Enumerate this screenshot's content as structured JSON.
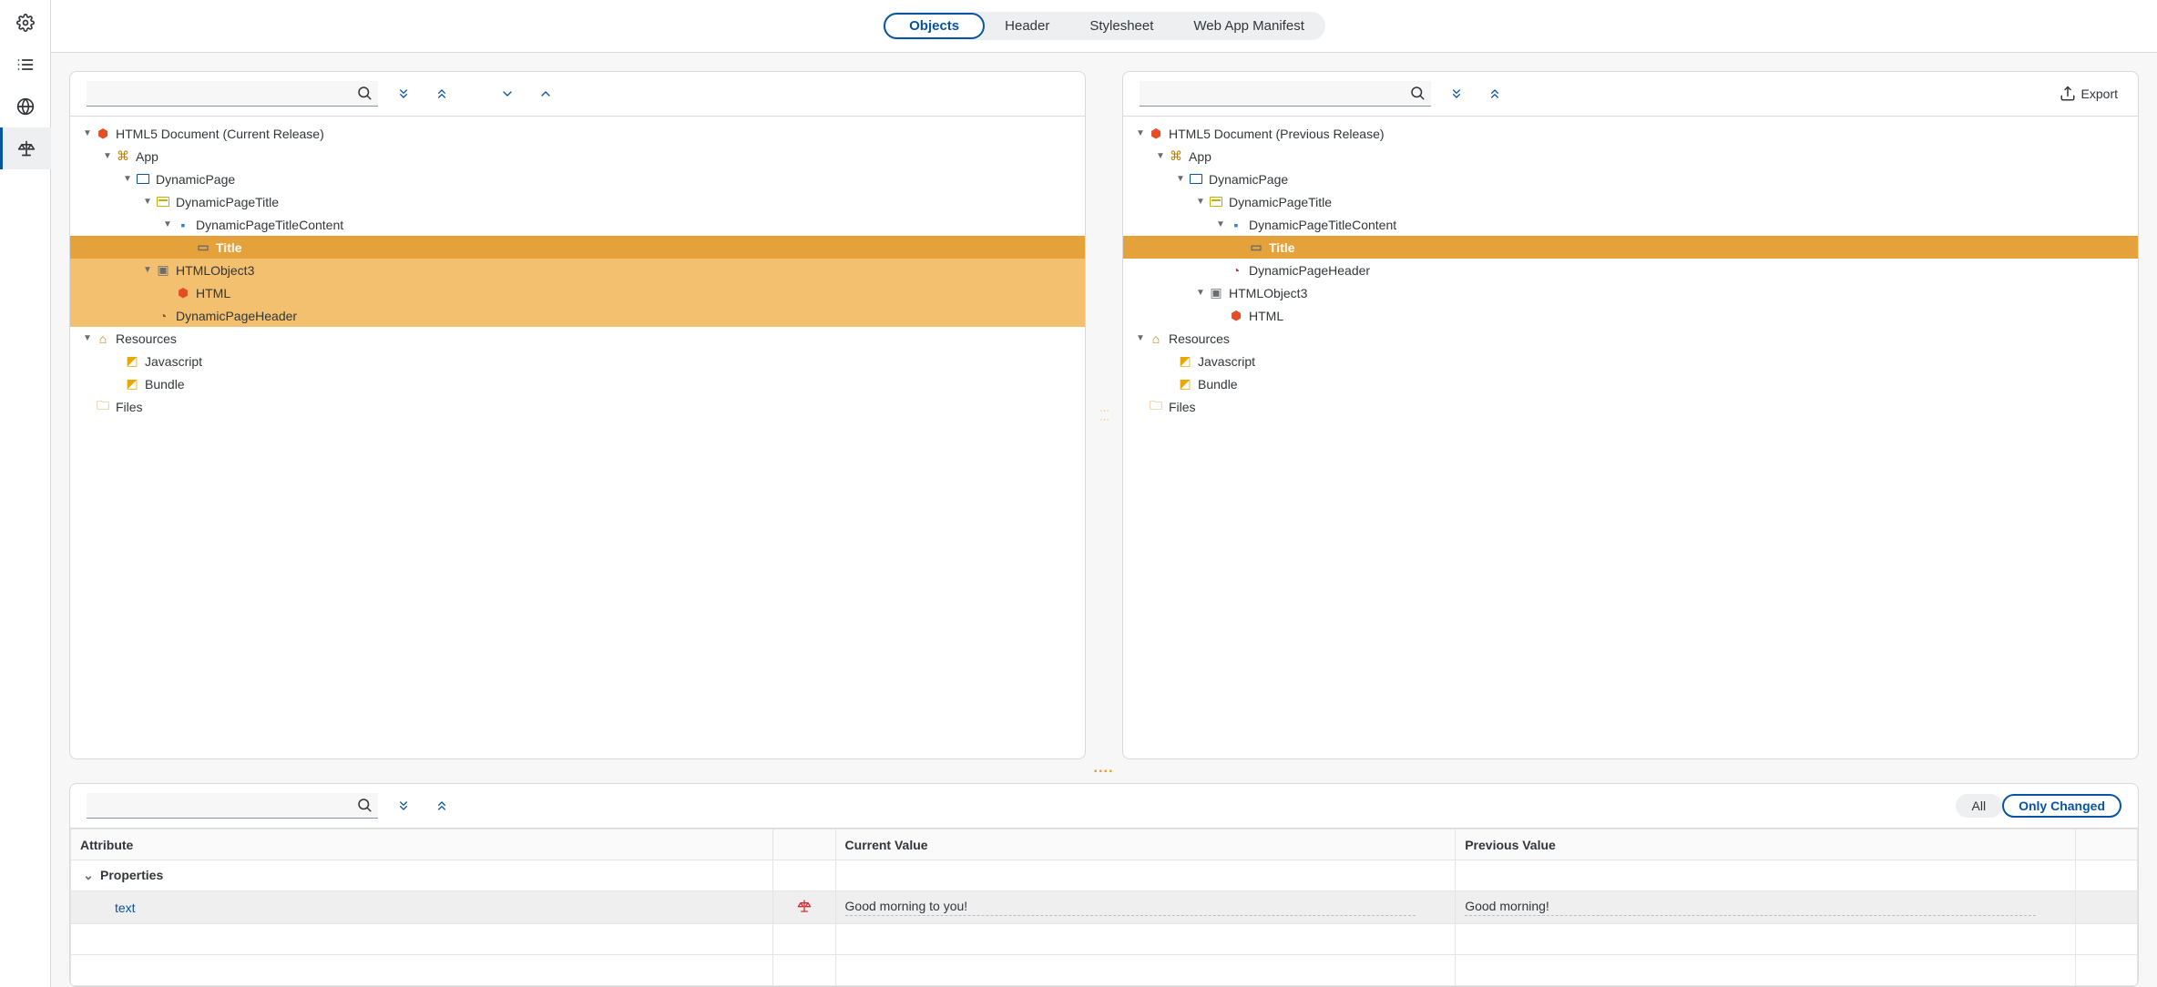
{
  "tabs": {
    "objects": "Objects",
    "header": "Header",
    "stylesheet": "Stylesheet",
    "manifest": "Web App Manifest"
  },
  "export": "Export",
  "filter": {
    "all": "All",
    "onlyChanged": "Only Changed"
  },
  "leftTitle": "HTML5 Document (Current Release)",
  "rightTitle": "HTML5 Document (Previous Release)",
  "leftTree": {
    "app": "App",
    "dynamicPage": "DynamicPage",
    "dynamicPageTitle": "DynamicPageTitle",
    "dynamicPageTitleContent": "DynamicPageTitleContent",
    "title": "Title",
    "htmlObject3": "HTMLObject3",
    "html": "HTML",
    "dynamicPageHeader": "DynamicPageHeader",
    "resources": "Resources",
    "javascript": "Javascript",
    "bundle": "Bundle",
    "files": "Files"
  },
  "rightTree": {
    "app": "App",
    "dynamicPage": "DynamicPage",
    "dynamicPageTitle": "DynamicPageTitle",
    "dynamicPageTitleContent": "DynamicPageTitleContent",
    "title": "Title",
    "dynamicPageHeader": "DynamicPageHeader",
    "htmlObject3": "HTMLObject3",
    "html": "HTML",
    "resources": "Resources",
    "javascript": "Javascript",
    "bundle": "Bundle",
    "files": "Files"
  },
  "attrTable": {
    "colAttr": "Attribute",
    "colCur": "Current Value",
    "colPrev": "Previous Value",
    "group": "Properties",
    "row": {
      "name": "text",
      "current": "Good morning to you!",
      "previous": "Good morning!"
    }
  }
}
